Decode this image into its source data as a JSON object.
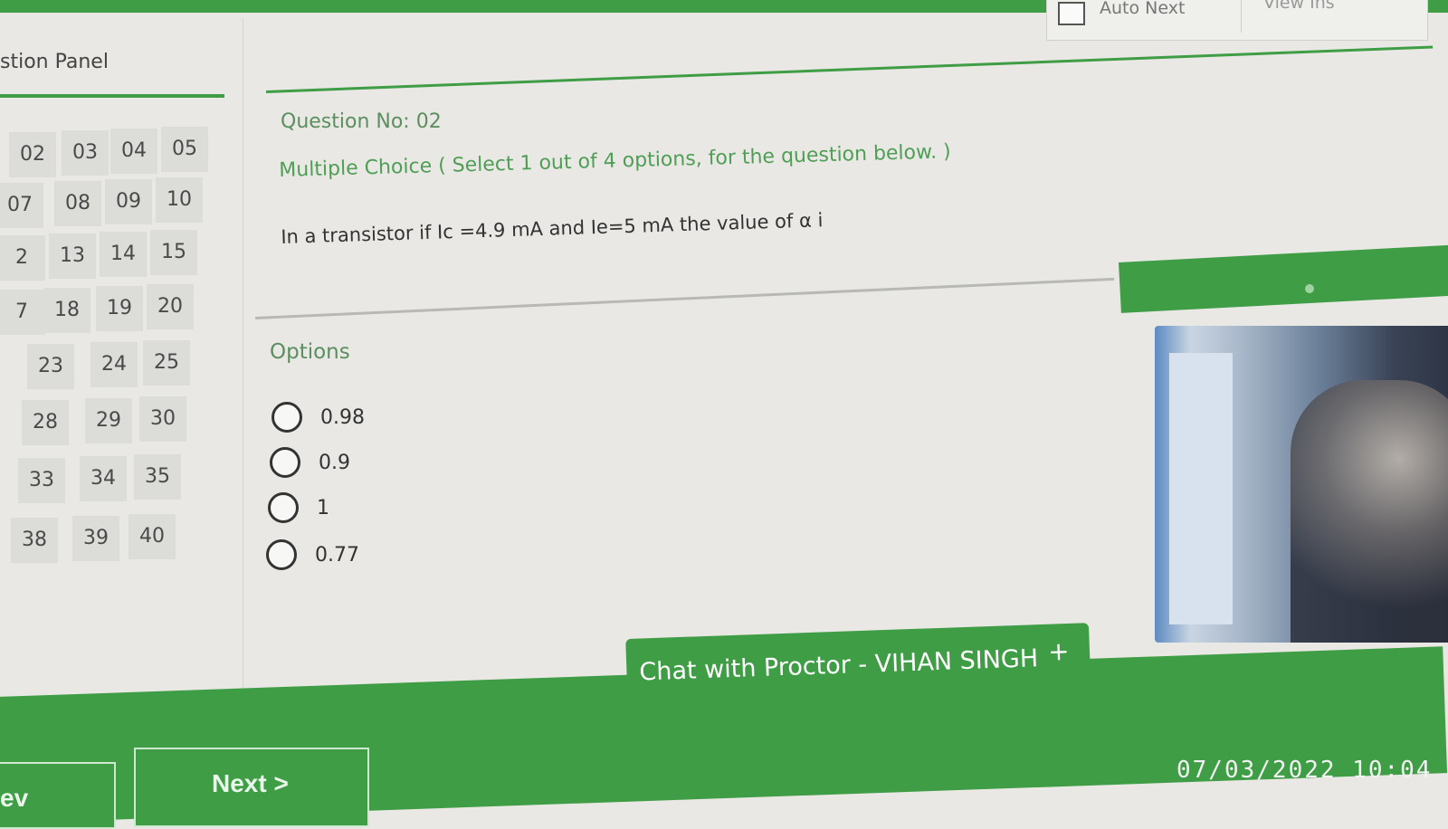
{
  "top": {
    "auto_next_label": "Auto Next",
    "view_label": "View Ins"
  },
  "panel": {
    "title": "stion Panel",
    "questions": [
      "02",
      "03",
      "04",
      "05",
      "07",
      "08",
      "09",
      "10",
      "2",
      "13",
      "14",
      "15",
      "7",
      "18",
      "19",
      "20",
      "23",
      "24",
      "25",
      "28",
      "29",
      "30",
      "33",
      "34",
      "35",
      "38",
      "39",
      "40"
    ]
  },
  "question": {
    "number_label": "Question No: 02",
    "type_label": "Multiple Choice ( Select 1 out of 4 options, for the question below. )",
    "text": "In a transistor if Ic =4.9 mA and Ie=5 mA the value of α i"
  },
  "options": {
    "title": "Options",
    "items": [
      "0.98",
      "0.9",
      "1",
      "0.77"
    ]
  },
  "chat": {
    "label": "Chat with Proctor - VIHAN SINGH",
    "plus": "+"
  },
  "footer": {
    "prev_label": "ev",
    "next_label": "Next >",
    "timestamp": "07/03/2022 10:04"
  },
  "colors": {
    "accent": "#3f9d45",
    "background": "#e9e8e4",
    "cell": "#dcdcd8"
  }
}
